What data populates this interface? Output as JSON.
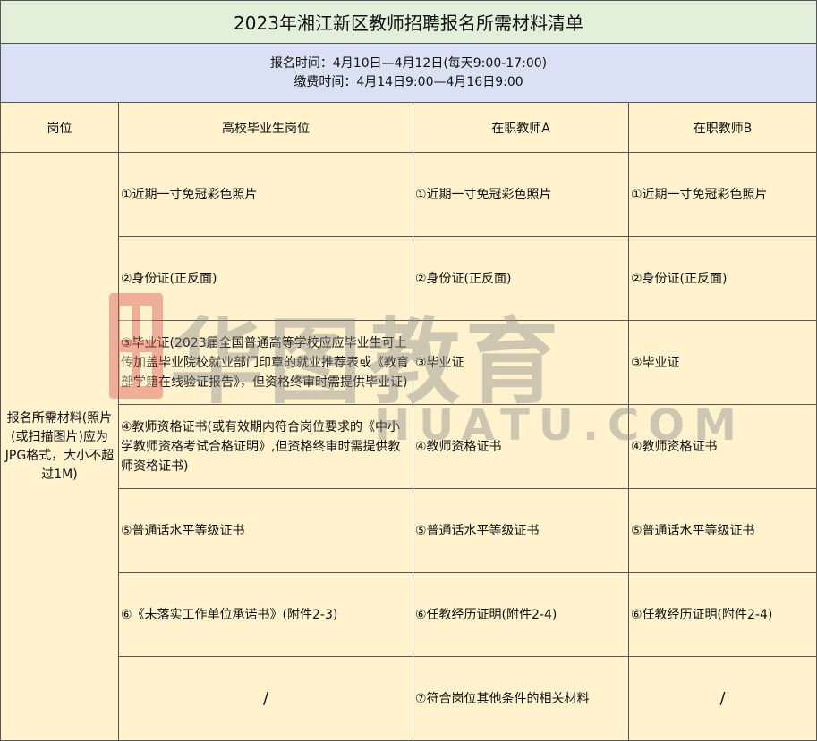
{
  "title": "2023年湘江新区教师招聘报名所需材料清单",
  "times": {
    "registration": "报名时间：4月10日—4月12日(每天9:00-17:00)",
    "payment": "缴费时间：4月14日9:00—4月16日9:00"
  },
  "headers": [
    "岗位",
    "高校毕业生岗位",
    "在职教师A",
    "在职教师B"
  ],
  "side_label": "报名所需材料(照片(或扫描图片)应为JPG格式，大小不超过1M)",
  "rows": [
    [
      "①近期一寸免冠彩色照片",
      "①近期一寸免冠彩色照片",
      "①近期一寸免冠彩色照片"
    ],
    [
      "②身份证(正反面)",
      "②身份证(正反面)",
      "②身份证(正反面)"
    ],
    [
      "③毕业证(2023届全国普通高等学校应应毕业生可上传加盖毕业院校就业部门印章的就业推荐表或《教育部学籍在线验证报告》，但资格终审时需提供毕业证)",
      "③毕业证",
      "③毕业证"
    ],
    [
      "④教师资格证书(或有效期内符合岗位要求的《中小学教师资格考试合格证明》,但资格终审时需提供教师资格证书)",
      "④教师资格证书",
      "④教师资格证书"
    ],
    [
      "⑤普通话水平等级证书",
      "⑤普通话水平等级证书",
      "⑤普通话水平等级证书"
    ],
    [
      "⑥《未落实工作单位承诺书》(附件2-3)",
      "⑥任教经历证明(附件2-4)",
      "⑥任教经历证明(附件2-4)"
    ],
    [
      "/",
      "⑦符合岗位其他条件的相关材料",
      "/"
    ]
  ],
  "watermark": {
    "icon": "huatu-logo-icon",
    "text": "华图教育",
    "sub": "HUATU.COM",
    "brand_color": "#d9534f"
  }
}
